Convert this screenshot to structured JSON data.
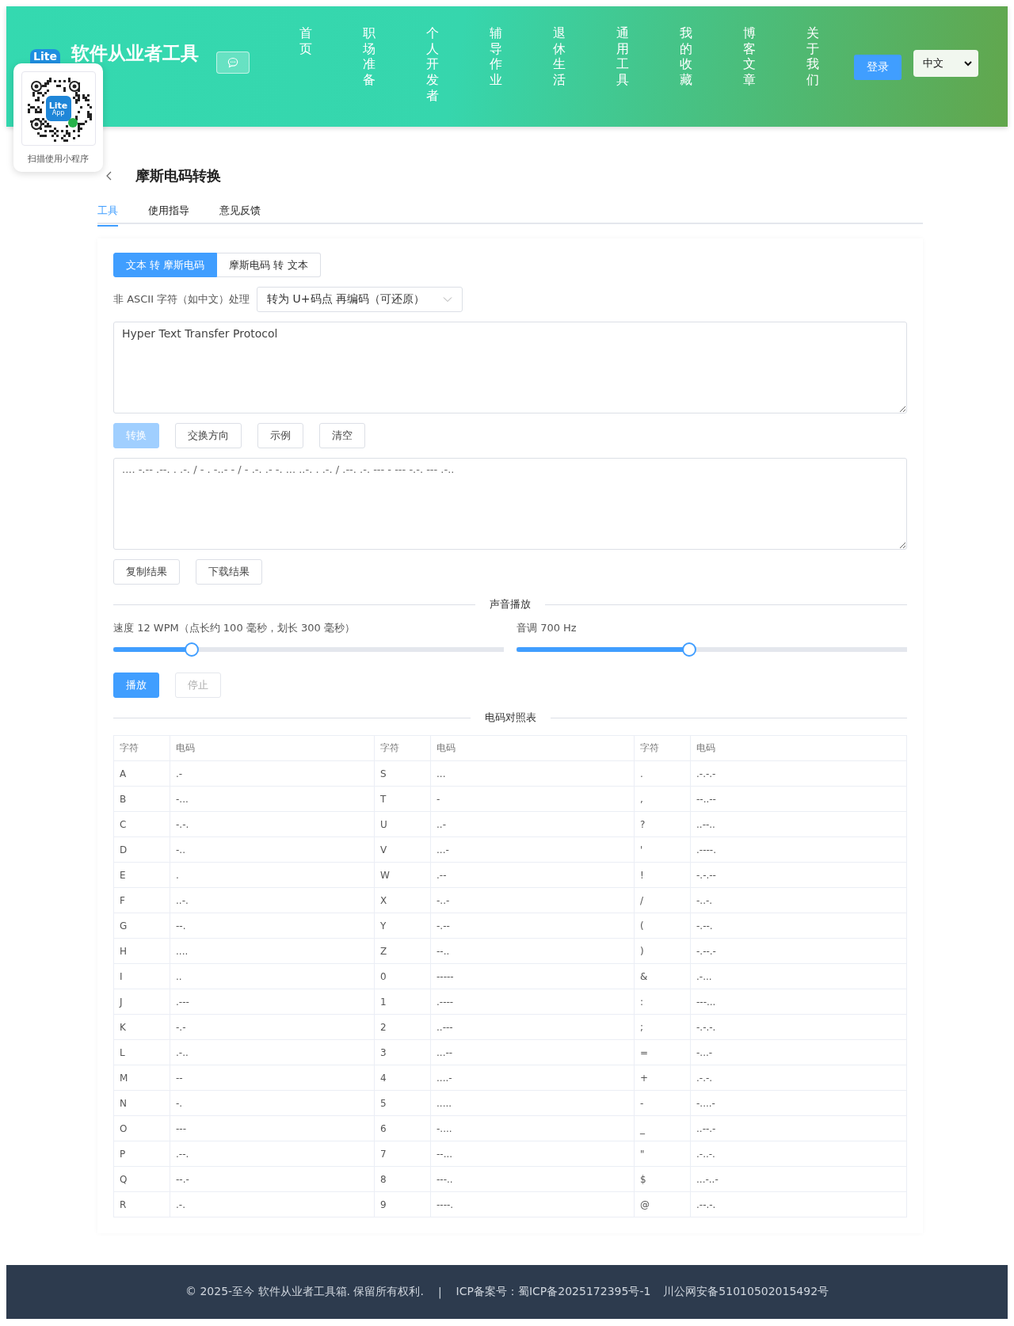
{
  "header": {
    "logo_text": "Lite",
    "site_title": "软件从业者工具",
    "nav": [
      {
        "label": "首页"
      },
      {
        "label": "职场准备"
      },
      {
        "label": "个人开发者"
      },
      {
        "label": "辅导作业"
      },
      {
        "label": "退休生活"
      },
      {
        "label": "通用工具"
      },
      {
        "label": "我的收藏"
      },
      {
        "label": "博客文章"
      },
      {
        "label": "关于我们"
      }
    ],
    "login_button": "登录",
    "language": "中文"
  },
  "mini_program_card": {
    "logo_lines": [
      "Lite",
      "App"
    ],
    "caption": "扫描使用小程序"
  },
  "page": {
    "title": "摩斯电码转换",
    "tabs": [
      {
        "label": "工具",
        "selected": true
      },
      {
        "label": "使用指导",
        "selected": false
      },
      {
        "label": "意见反馈",
        "selected": false
      }
    ]
  },
  "tool": {
    "modes": [
      {
        "label": "文本 转 摩斯电码",
        "selected": true
      },
      {
        "label": "摩斯电码 转 文本",
        "selected": false
      }
    ],
    "non_ascii_label": "非 ASCII 字符（如中文）处理",
    "non_ascii_value": "转为 U+码点 再编码（可还原）",
    "input_text": "Hyper Text Transfer Protocol",
    "actions": [
      {
        "label": "转换",
        "kind": "primary",
        "disabled": true
      },
      {
        "label": "交换方向",
        "kind": "default",
        "disabled": false
      },
      {
        "label": "示例",
        "kind": "default",
        "disabled": false
      },
      {
        "label": "清空",
        "kind": "default",
        "disabled": false
      }
    ],
    "output_text": ".... -.-- .--. . .-. / - . -..- - / - .-. .- -. ... ..-. . .-. / .--. .-. --- - --- -.-. --- .-..",
    "result_actions": [
      {
        "label": "复制结果"
      },
      {
        "label": "下载结果"
      }
    ],
    "sound_heading": "声音播放",
    "sliders": [
      {
        "label": "速度 12 WPM（点长约 100 毫秒，划长 300 毫秒）",
        "level": 0.2
      },
      {
        "label": "音调 700 Hz",
        "level": 0.443
      }
    ],
    "play_buttons": [
      {
        "label": "播放",
        "kind": "primary",
        "disabled": false
      },
      {
        "label": "停止",
        "kind": "default",
        "disabled": true
      }
    ],
    "table_heading": "电码对照表"
  },
  "table": {
    "columns": [
      "字符",
      "电码",
      "字符",
      "电码",
      "字符",
      "电码"
    ],
    "rows": [
      [
        "A",
        ".-",
        "S",
        "...",
        ".",
        ".-.-.-"
      ],
      [
        "B",
        "-...",
        "T",
        "-",
        ",",
        "--..--"
      ],
      [
        "C",
        "-.-.",
        "U",
        "..-",
        "?",
        "..--.."
      ],
      [
        "D",
        "-..",
        "V",
        "...-",
        "'",
        ".----."
      ],
      [
        "E",
        ".",
        "W",
        ".--",
        "!",
        "-.-.--"
      ],
      [
        "F",
        "..-.",
        "X",
        "-..-",
        "/",
        "-..-."
      ],
      [
        "G",
        "--.",
        "Y",
        "-.--",
        "(",
        "-.--."
      ],
      [
        "H",
        "....",
        "Z",
        "--..",
        ")",
        "-.--.-"
      ],
      [
        "I",
        "..",
        "0",
        "-----",
        "&",
        ".-..."
      ],
      [
        "J",
        ".---",
        "1",
        ".----",
        ":",
        "---..."
      ],
      [
        "K",
        "-.-",
        "2",
        "..---",
        ";",
        "-.-.-."
      ],
      [
        "L",
        ".-..",
        "3",
        "...--",
        "=",
        "-...-"
      ],
      [
        "M",
        "--",
        "4",
        "....-",
        "+",
        ".-.-."
      ],
      [
        "N",
        "-.",
        "5",
        ".....",
        "-",
        "-....-"
      ],
      [
        "O",
        "---",
        "6",
        "-....",
        "_",
        "..--.-"
      ],
      [
        "P",
        ".--.",
        "7",
        "--...",
        "\"",
        ".-..-."
      ],
      [
        "Q",
        "--.-",
        "8",
        "---..",
        "$",
        "...-..-"
      ],
      [
        "R",
        ".-.",
        "9",
        "----.",
        "@",
        ".--.-."
      ]
    ]
  },
  "footer": {
    "copyright": "© 2025-至今 软件从业者工具箱. 保留所有权利.",
    "separator": "|",
    "icp": "ICP备案号：蜀ICP备2025172395号-1",
    "police": "川公网安备51010502015492号"
  }
}
